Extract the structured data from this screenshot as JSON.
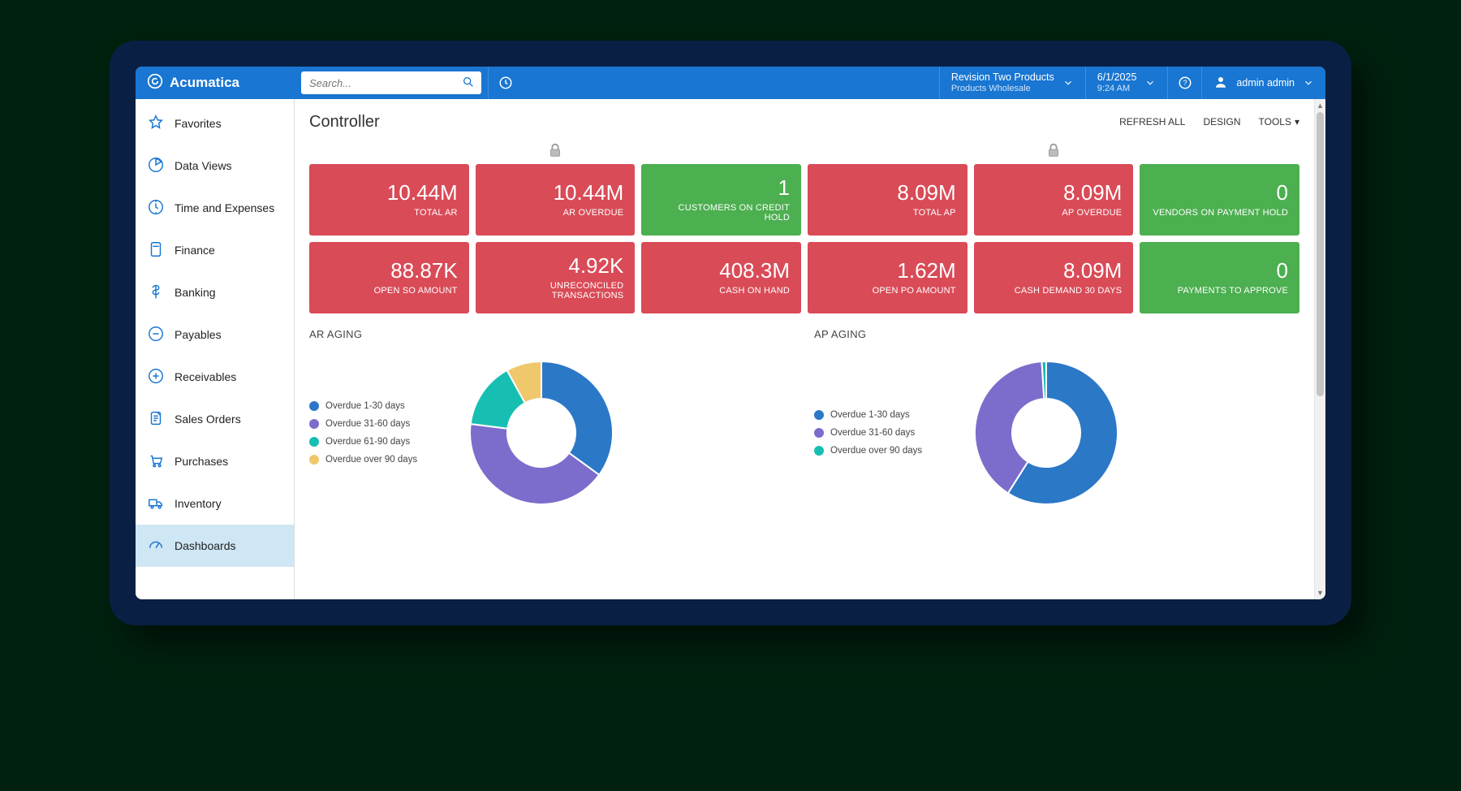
{
  "app_name": "Acumatica",
  "search": {
    "placeholder": "Search..."
  },
  "header": {
    "company_top": "Revision Two Products",
    "company_bottom": "Products Wholesale",
    "date": "6/1/2025",
    "time": "9:24 AM",
    "user": "admin admin"
  },
  "sidebar": {
    "items": [
      {
        "label": "Favorites",
        "icon": "star"
      },
      {
        "label": "Data Views",
        "icon": "chart"
      },
      {
        "label": "Time and Expenses",
        "icon": "clock"
      },
      {
        "label": "Finance",
        "icon": "calc"
      },
      {
        "label": "Banking",
        "icon": "dollar"
      },
      {
        "label": "Payables",
        "icon": "minus-circle"
      },
      {
        "label": "Receivables",
        "icon": "plus-circle"
      },
      {
        "label": "Sales Orders",
        "icon": "doc"
      },
      {
        "label": "Purchases",
        "icon": "cart"
      },
      {
        "label": "Inventory",
        "icon": "truck"
      },
      {
        "label": "Dashboards",
        "icon": "gauge"
      }
    ],
    "selected_index": 10
  },
  "page": {
    "title": "Controller",
    "actions": {
      "refresh": "REFRESH ALL",
      "design": "DESIGN",
      "tools": "TOOLS"
    }
  },
  "kpis": [
    {
      "value": "10.44M",
      "label": "TOTAL AR",
      "color": "red"
    },
    {
      "value": "10.44M",
      "label": "AR OVERDUE",
      "color": "red"
    },
    {
      "value": "1",
      "label": "CUSTOMERS ON CREDIT HOLD",
      "color": "green"
    },
    {
      "value": "8.09M",
      "label": "TOTAL AP",
      "color": "red"
    },
    {
      "value": "8.09M",
      "label": "AP OVERDUE",
      "color": "red"
    },
    {
      "value": "0",
      "label": "VENDORS ON PAYMENT HOLD",
      "color": "green"
    },
    {
      "value": "88.87K",
      "label": "OPEN SO AMOUNT",
      "color": "red"
    },
    {
      "value": "4.92K",
      "label": "UNRECONCILED TRANSACTIONS",
      "color": "red"
    },
    {
      "value": "408.3M",
      "label": "CASH ON HAND",
      "color": "red"
    },
    {
      "value": "1.62M",
      "label": "OPEN PO AMOUNT",
      "color": "red"
    },
    {
      "value": "8.09M",
      "label": "CASH DEMAND 30 DAYS",
      "color": "red"
    },
    {
      "value": "0",
      "label": "PAYMENTS TO APPROVE",
      "color": "green"
    }
  ],
  "chart_data": [
    {
      "id": "ar_aging",
      "title": "AR AGING",
      "type": "pie",
      "series": [
        {
          "name": "Overdue 1-30 days",
          "value": 35,
          "color": "#2b78c7"
        },
        {
          "name": "Overdue 31-60 days",
          "value": 42,
          "color": "#7c6dcc"
        },
        {
          "name": "Overdue 61-90 days",
          "value": 15,
          "color": "#17bfb2"
        },
        {
          "name": "Overdue over 90 days",
          "value": 8,
          "color": "#f0c86c"
        }
      ]
    },
    {
      "id": "ap_aging",
      "title": "AP AGING",
      "type": "pie",
      "series": [
        {
          "name": "Overdue 1-30 days",
          "value": 59,
          "color": "#2b78c7"
        },
        {
          "name": "Overdue 31-60 days",
          "value": 40,
          "color": "#7c6dcc"
        },
        {
          "name": "Overdue over 90 days",
          "value": 1,
          "color": "#17bfb2"
        }
      ]
    }
  ]
}
